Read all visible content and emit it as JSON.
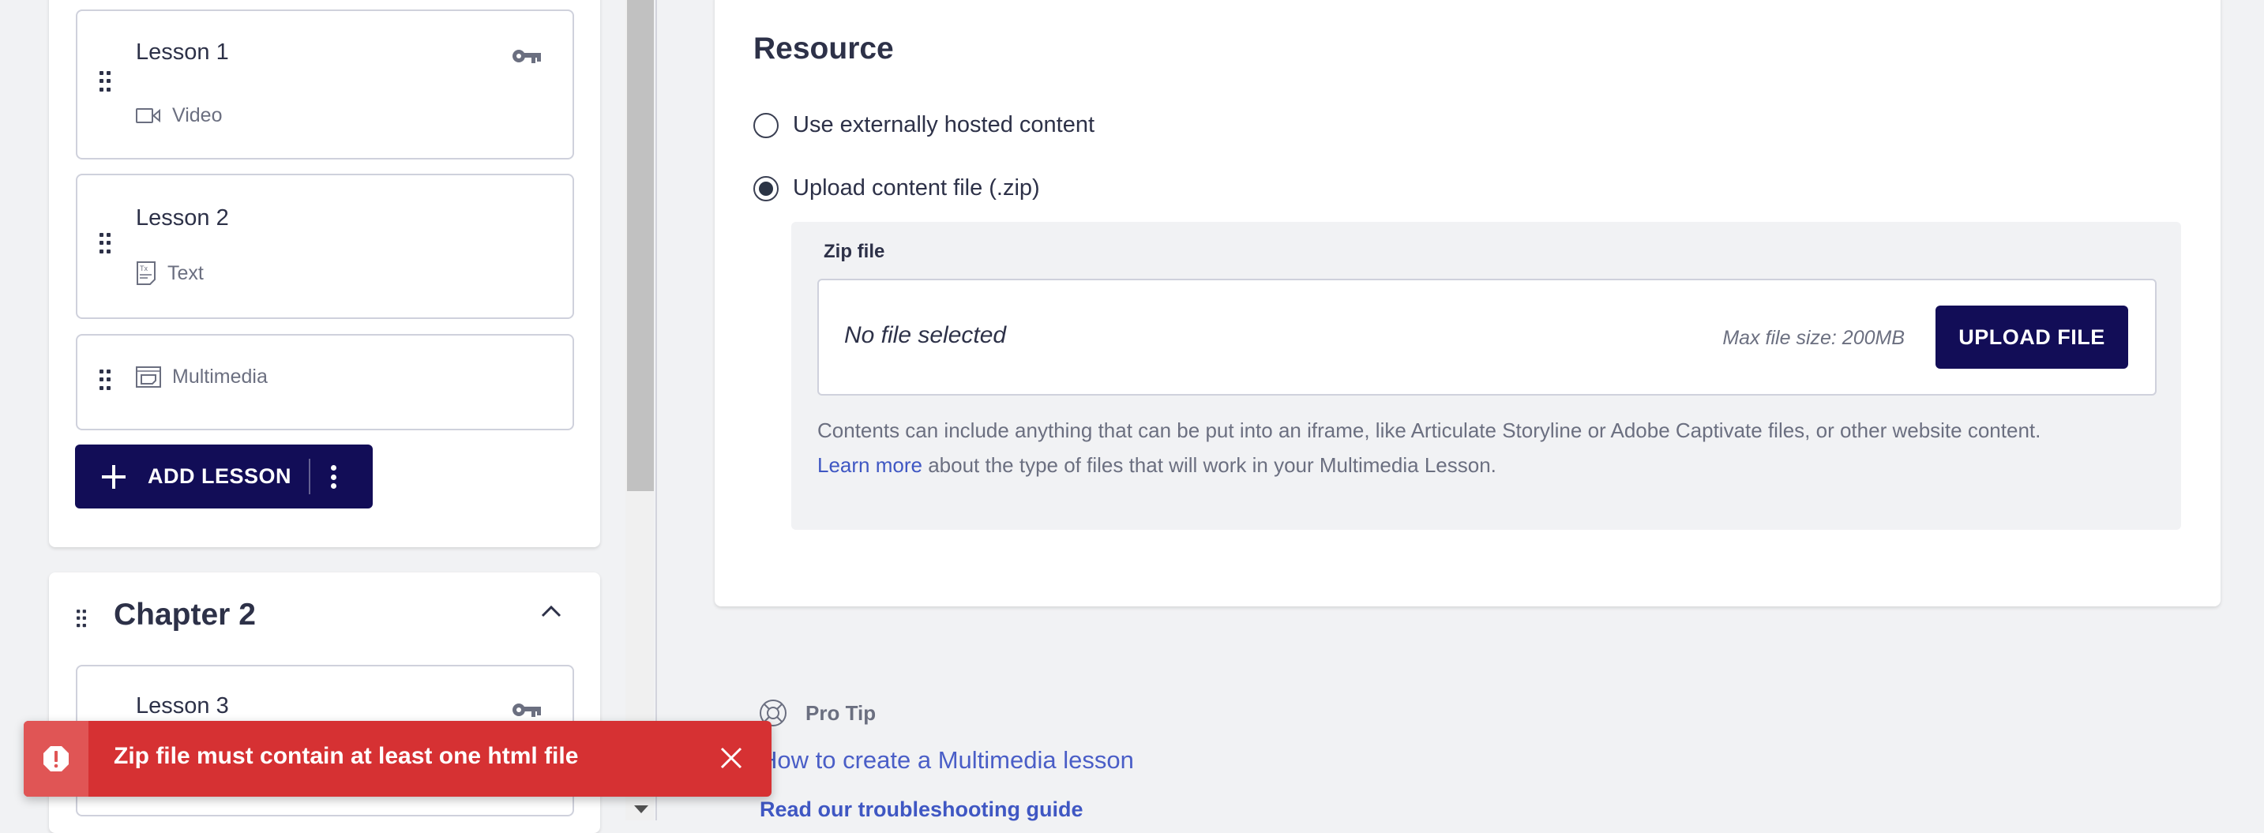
{
  "sidebar": {
    "chapters": [
      {
        "lessons": [
          {
            "title": "Lesson 1",
            "type": "Video",
            "type_icon": "video-icon",
            "locked": true
          },
          {
            "title": "Lesson 2",
            "type": "Text",
            "type_icon": "text-doc-icon",
            "locked": false
          },
          {
            "title": "",
            "type": "Multimedia",
            "type_icon": "multimedia-icon",
            "locked": false
          }
        ],
        "add_lesson_label": "ADD LESSON"
      },
      {
        "title": "Chapter 2",
        "expanded": true,
        "lessons": [
          {
            "title": "Lesson 3",
            "locked": true
          }
        ]
      }
    ]
  },
  "main": {
    "section_title": "Resource",
    "options": [
      {
        "label": "Use externally hosted content",
        "selected": false
      },
      {
        "label": "Upload content file (.zip)",
        "selected": true
      }
    ],
    "zip": {
      "label": "Zip file",
      "value": "No file selected",
      "max_size": "Max file size: 200MB",
      "upload_label": "UPLOAD FILE",
      "help_line1": "Contents can include anything that can be put into an iframe, like Articulate Storyline or Adobe Captivate files, or other website content.",
      "learn_more": "Learn more",
      "help_line2": " about the type of files that will work in your Multimedia Lesson."
    },
    "protip": {
      "label": "Pro Tip",
      "link": "How to create a Multimedia lesson",
      "troubleshooting": "Read our troubleshooting guide"
    }
  },
  "toast": {
    "type": "error",
    "message": "Zip file must contain at least one html file",
    "color": "#d63133"
  },
  "colors": {
    "primary": "#120d57",
    "link": "#3f57c3",
    "error": "#d63133"
  }
}
